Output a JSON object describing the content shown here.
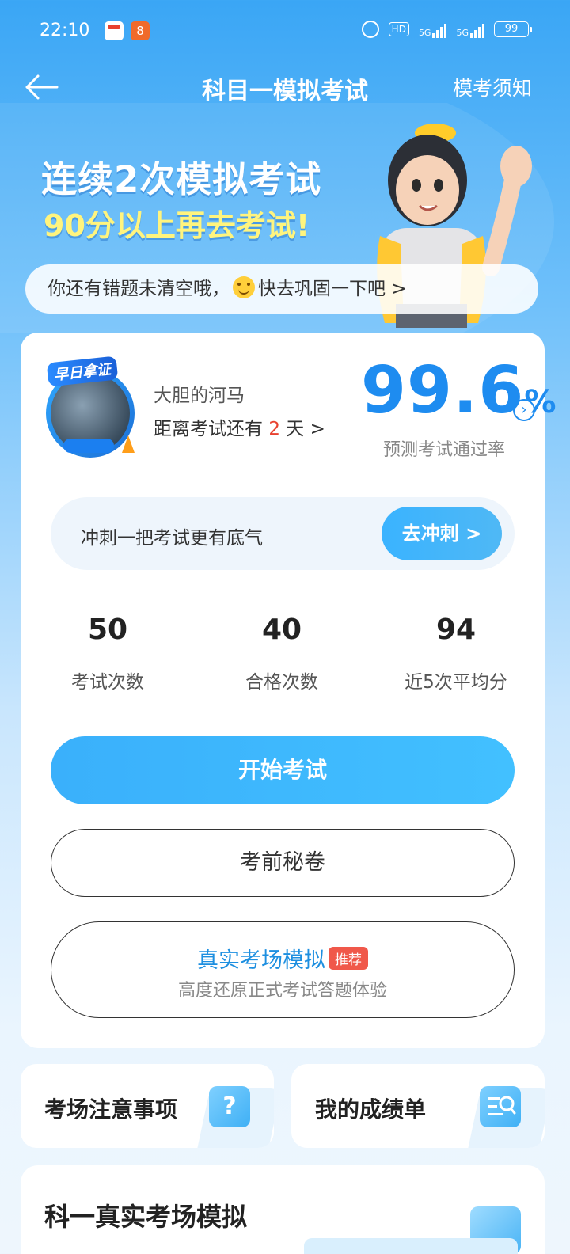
{
  "status_bar": {
    "time": "22:10",
    "hd_label": "HD",
    "net1": "5G",
    "net2": "5G",
    "battery": "99"
  },
  "nav": {
    "title": "科目一模拟考试",
    "notice": "模考须知"
  },
  "hero": {
    "line1": "连续2次模拟考试",
    "line2": "90分以上再去考试!"
  },
  "tip": {
    "text_before": "你还有错题未清空哦，",
    "text_after": "快去巩固一下吧 >"
  },
  "profile": {
    "badge": "早日拿证",
    "name": "大胆的河马",
    "countdown_prefix": "距离考试还有",
    "countdown_days": "2",
    "countdown_suffix": "天 >"
  },
  "pass_rate": {
    "value": "99.6",
    "unit": "%",
    "label": "预测考试通过率"
  },
  "sprint": {
    "text": "冲刺一把考试更有底气",
    "button": "去冲刺 >"
  },
  "stats": [
    {
      "value": "50",
      "label": "考试次数"
    },
    {
      "value": "40",
      "label": "合格次数"
    },
    {
      "value": "94",
      "label": "近5次平均分"
    }
  ],
  "buttons": {
    "start": "开始考试",
    "secret": "考前秘卷",
    "real_title": "真实考场模拟",
    "real_tag": "推荐",
    "real_sub": "高度还原正式考试答题体验"
  },
  "shortcuts": {
    "notice": "考场注意事项",
    "notice_icon": "?",
    "scores": "我的成绩单"
  },
  "bottom": {
    "title": "科一真实考场模拟"
  },
  "colors": {
    "primary": "#1e8cf0",
    "accent_yellow": "#fff47e",
    "highlight_red": "#e8412f"
  }
}
